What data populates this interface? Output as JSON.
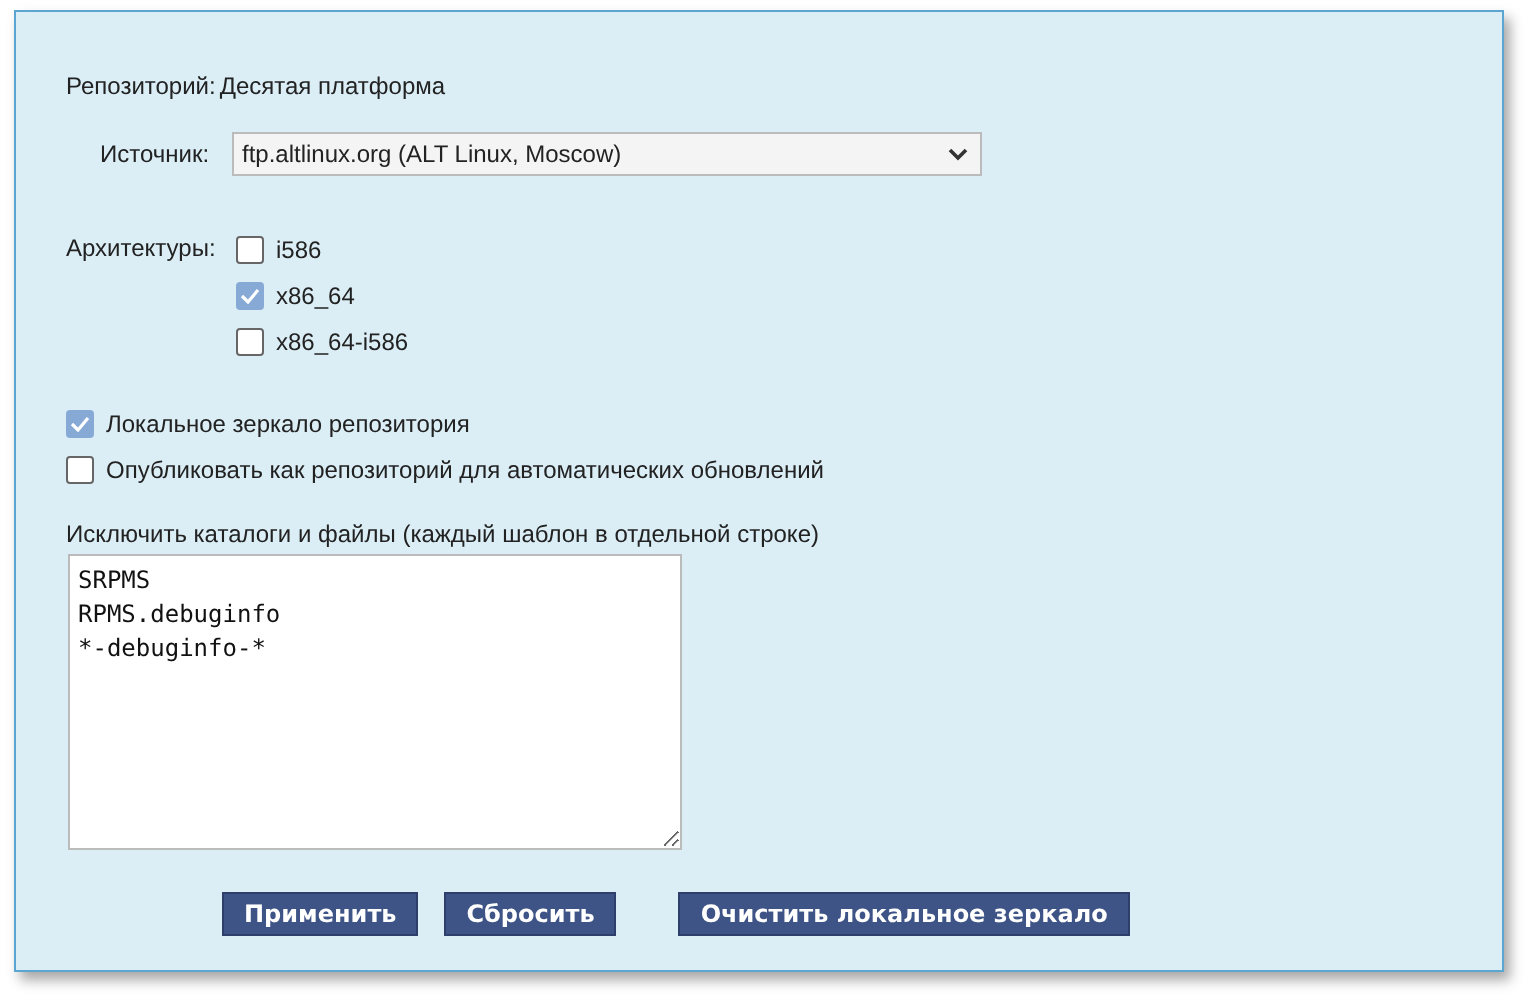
{
  "repository": {
    "label": "Репозиторий:",
    "value": "Десятая платформа"
  },
  "source": {
    "label": "Источник:",
    "value": "ftp.altlinux.org (ALT Linux, Moscow)"
  },
  "architectures": {
    "label": "Архитектуры:",
    "items": [
      {
        "label": "i586",
        "checked": false
      },
      {
        "label": "x86_64",
        "checked": true
      },
      {
        "label": "x86_64-i586",
        "checked": false
      }
    ]
  },
  "options": [
    {
      "label": "Локальное зеркало репозитория",
      "checked": true
    },
    {
      "label": "Опубликовать как репозиторий для автоматических обновлений",
      "checked": false
    }
  ],
  "exclude": {
    "label": "Исключить каталоги и файлы (каждый шаблон в отдельной строке)",
    "value": "SRPMS\nRPMS.debuginfo\n*-debuginfo-*"
  },
  "buttons": [
    {
      "label": "Применить"
    },
    {
      "label": "Сбросить"
    },
    {
      "label": "Очистить локальное зеркало"
    }
  ]
}
